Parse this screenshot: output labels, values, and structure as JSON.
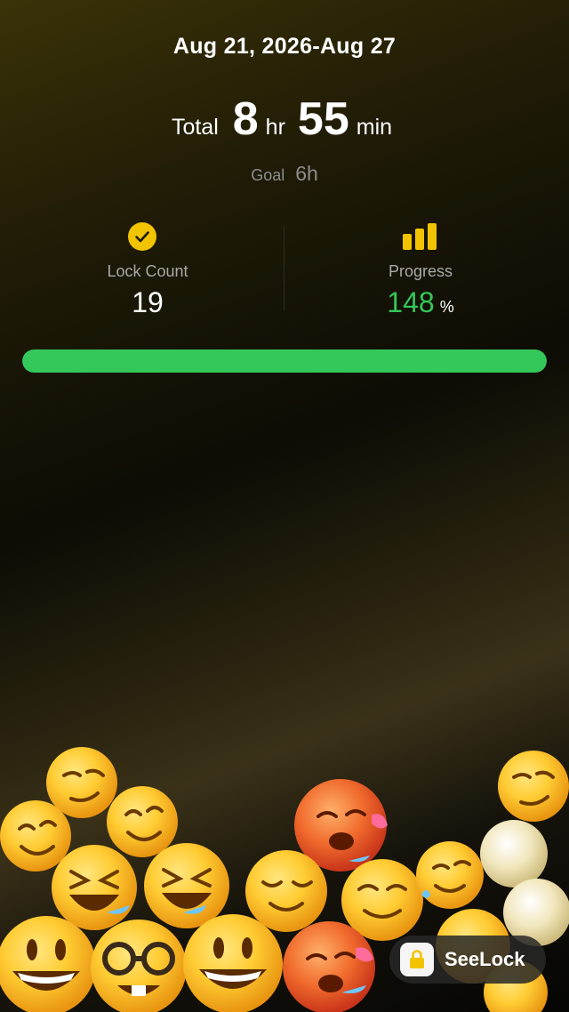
{
  "header": {
    "date_range": "Aug 21, 2026-Aug 27"
  },
  "total": {
    "label": "Total",
    "hours": "8",
    "hours_unit": "hr",
    "minutes": "55",
    "minutes_unit": "min"
  },
  "goal": {
    "label": "Goal",
    "value": "6h"
  },
  "stats": {
    "lock_count": {
      "icon": "check-circle-icon",
      "label": "Lock Count",
      "value": "19"
    },
    "progress": {
      "icon": "bar-chart-icon",
      "label": "Progress",
      "value": "148",
      "unit": "%"
    }
  },
  "progress_bar": {
    "fraction": 1.0,
    "color": "#34c759"
  },
  "colors": {
    "accent_green": "#34c759",
    "accent_yellow": "#f2c400"
  },
  "emoji_pile": [
    "smirking-face",
    "smiling-face",
    "grinning-squinting-face",
    "smiling-face-with-heart",
    "smiling-face",
    "hot-face",
    "grinning-face",
    "nerd-face",
    "grinning-face",
    "hot-face",
    "relieved-face",
    "smiling-face-with-tear",
    "kissing-face",
    "shaking-face",
    "smirking-face"
  ],
  "badge": {
    "label": "SeeLock",
    "icon": "lock-icon"
  }
}
